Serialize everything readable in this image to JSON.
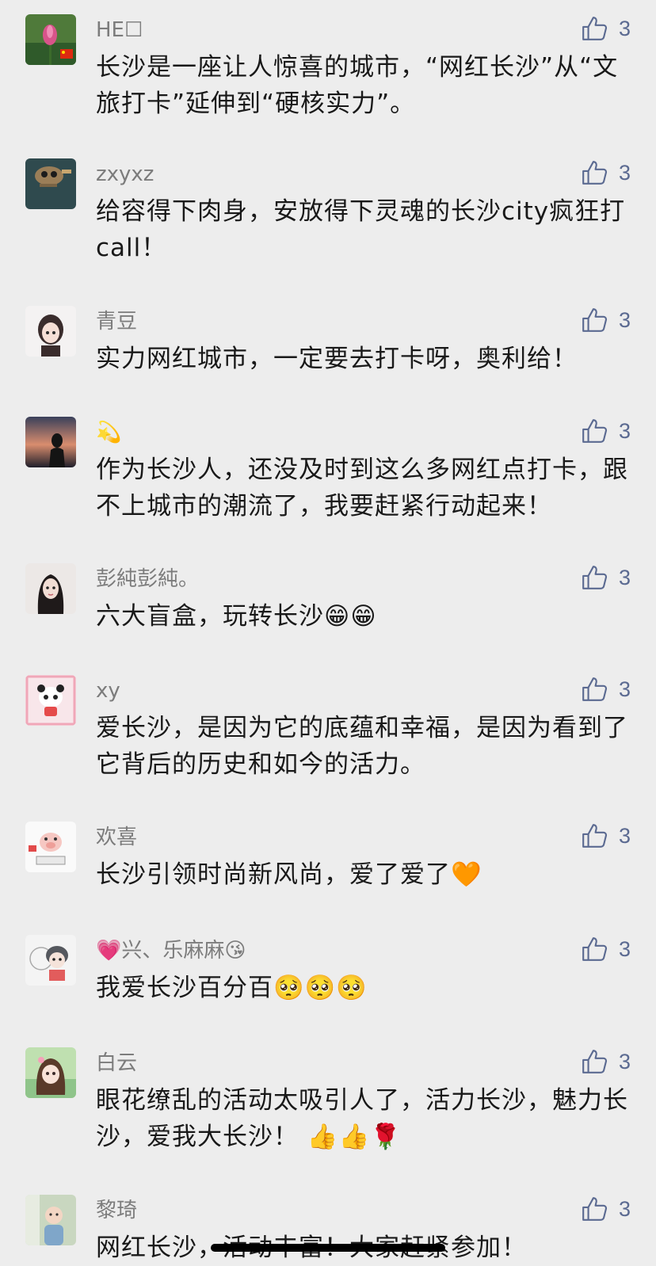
{
  "colors": {
    "background": "#ededed",
    "like_accent": "#5b6a91",
    "name": "#7c7c7c",
    "text": "#191919"
  },
  "comments": [
    {
      "name": "HE☐",
      "text": "长沙是一座让人惊喜的城市，“网红长沙”从“文旅打卡”延伸到“硬核实力”。",
      "likes": "3",
      "avatar_icon": "lotus-avatar-icon"
    },
    {
      "name": "zxyxz",
      "text": "给容得下肉身，安放得下灵魂的长沙city疯狂打call！",
      "likes": "3",
      "avatar_icon": "cat-avatar-icon"
    },
    {
      "name": "青豆",
      "text": "实力网红城市，一定要去打卡呀，奥利给！",
      "likes": "3",
      "avatar_icon": "doll-avatar-icon"
    },
    {
      "name": "💫",
      "text": "作为长沙人，还没及时到这么多网红点打卡，跟不上城市的潮流了，我要赶紧行动起来！",
      "likes": "3",
      "avatar_icon": "sunset-avatar-icon"
    },
    {
      "name": "彭純彭純。",
      "text": "六大盲盒，玩转长沙😁😁",
      "likes": "3",
      "avatar_icon": "girl-avatar-icon"
    },
    {
      "name": "xy",
      "text": "爱长沙，是因为它的底蕴和幸福，是因为看到了它背后的历史和如今的活力。",
      "likes": "3",
      "avatar_icon": "panda-avatar-icon"
    },
    {
      "name": "欢喜",
      "text": "长沙引领时尚新风尚，爱了爱了🧡",
      "likes": "3",
      "avatar_icon": "pig-avatar-icon"
    },
    {
      "name": "💗兴、乐麻麻😘",
      "text": "我爱长沙百分百🥺🥺🥺",
      "likes": "3",
      "avatar_icon": "cartoon-avatar-icon"
    },
    {
      "name": "白云",
      "text": "眼花缭乱的活动太吸引人了，活力长沙，魅力长沙，爱我大长沙！ 👍👍🌹",
      "likes": "3",
      "avatar_icon": "anime-avatar-icon"
    },
    {
      "name": "黎琦",
      "text": "网红长沙，活动丰富！大家赶紧参加！",
      "likes": "3",
      "avatar_icon": "baby-avatar-icon"
    }
  ]
}
